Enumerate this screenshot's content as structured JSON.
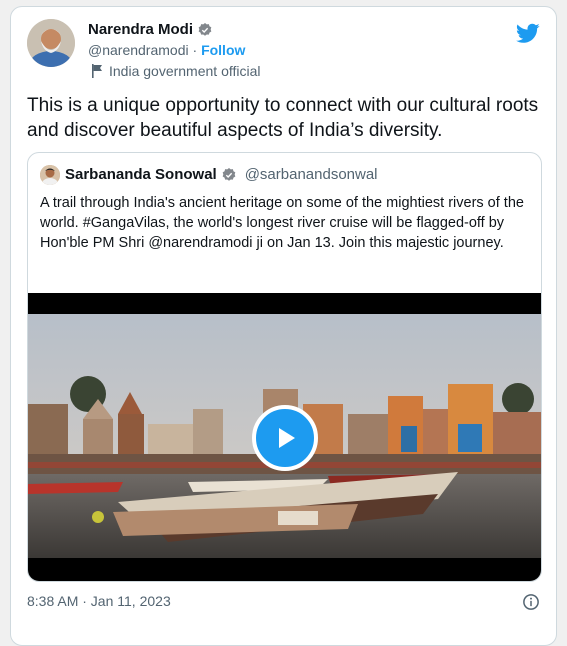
{
  "author": {
    "name": "Narendra Modi",
    "handle": "@narendramodi",
    "separator": "·",
    "follow_label": "Follow",
    "label": "India government official"
  },
  "tweet": {
    "text": "This is a unique opportunity to connect with our cultural roots and discover beautiful aspects of India’s diversity."
  },
  "quoted": {
    "name": "Sarbananda Sonowal",
    "handle": "@sarbanandsonwal",
    "text": "A trail through India's ancient heritage on some of the mightiest rivers of the world. #GangaVilas, the world's longest river cruise will be flagged-off by Hon'ble PM Shri @narendramodi ji on Jan 13. Join this majestic journey."
  },
  "footer": {
    "timestamp": "8:38 AM · Jan 11, 2023"
  },
  "icons": {
    "verified": "verified-badge-icon",
    "flag": "flag-icon",
    "brand": "twitter-bird-icon",
    "play": "play-icon",
    "info": "info-icon"
  },
  "colors": {
    "accent": "#1d9bf0",
    "text_primary": "#0f1419",
    "text_secondary": "#536471",
    "border": "#cfd9de"
  }
}
